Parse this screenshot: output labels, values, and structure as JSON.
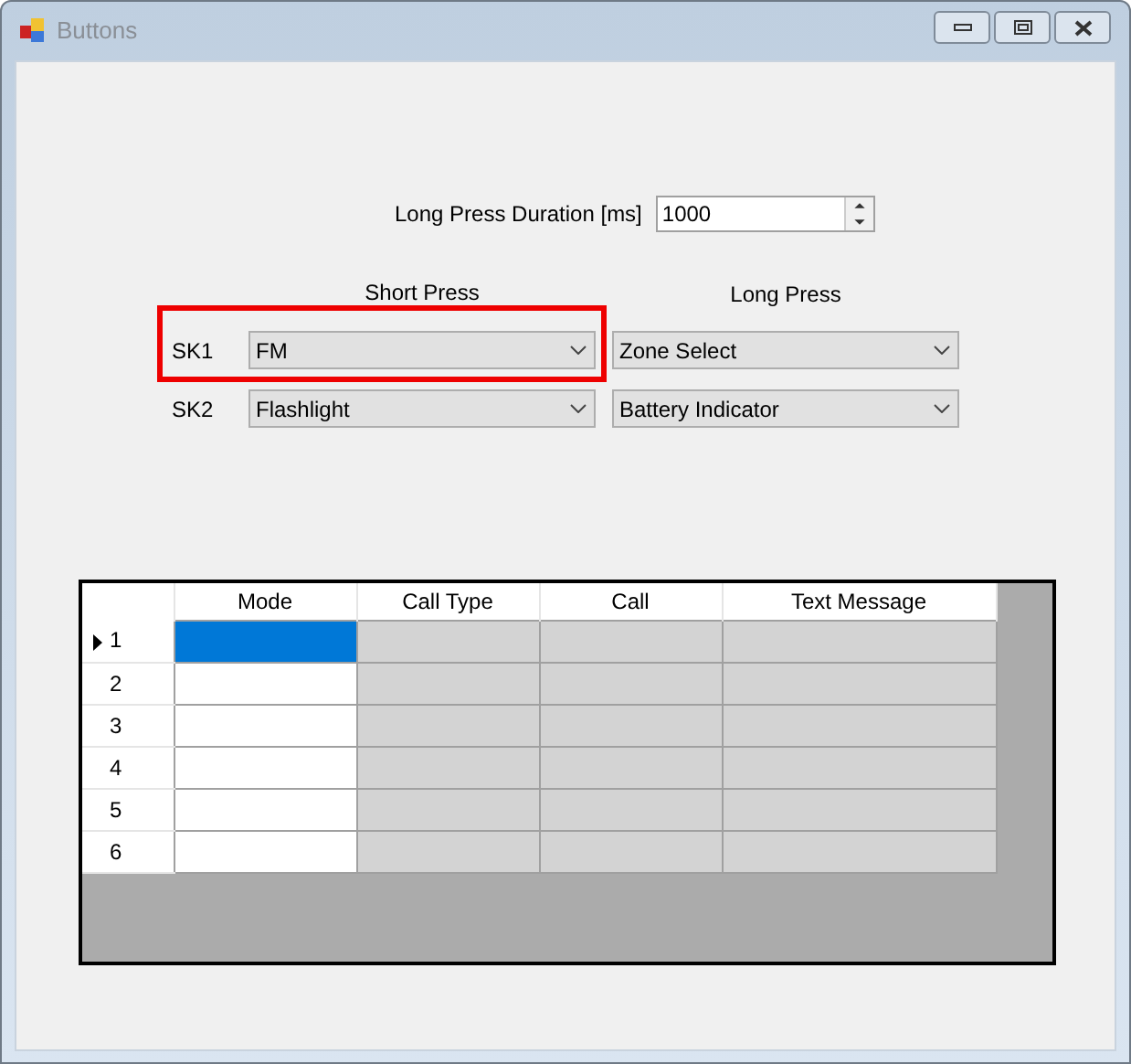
{
  "window": {
    "title": "Buttons"
  },
  "duration": {
    "label": "Long Press Duration [ms]",
    "value": "1000"
  },
  "press_headers": [
    "Short Press",
    "Long Press"
  ],
  "keys": [
    {
      "label": "SK1",
      "short_press": "FM",
      "long_press": "Zone Select",
      "highlighted": true
    },
    {
      "label": "SK2",
      "short_press": "Flashlight",
      "long_press": "Battery Indicator",
      "highlighted": false
    }
  ],
  "table": {
    "columns": [
      {
        "label": "Mode",
        "disabled": false
      },
      {
        "label": "Call Type",
        "disabled": true
      },
      {
        "label": "Call",
        "disabled": true
      },
      {
        "label": "Text Message",
        "disabled": true
      }
    ],
    "rows": [
      {
        "number": "1",
        "selected": true
      },
      {
        "number": "2",
        "selected": false
      },
      {
        "number": "3",
        "selected": false
      },
      {
        "number": "4",
        "selected": false
      },
      {
        "number": "5",
        "selected": false
      },
      {
        "number": "6",
        "selected": false
      }
    ]
  }
}
